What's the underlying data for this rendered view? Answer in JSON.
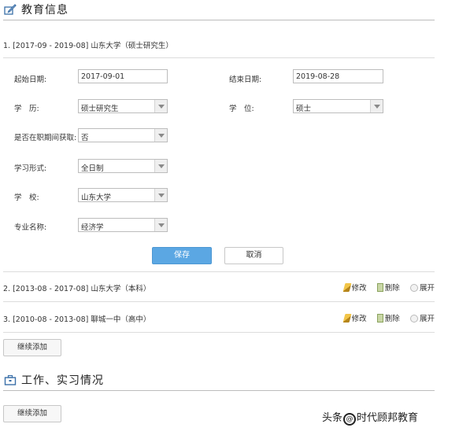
{
  "education": {
    "header_title": "教育信息",
    "expanded_entry": {
      "title": "1. [2017-09 - 2019-08] 山东大学（硕士研究生）",
      "fields": {
        "start_date_label": "起始日期:",
        "start_date_value": "2017-09-01",
        "end_date_label": "结束日期:",
        "end_date_value": "2019-08-28",
        "education_label": "学　历:",
        "education_value": "硕士研究生",
        "degree_label": "学　位:",
        "degree_value": "硕士",
        "during_job_label": "是否在职期间获取:",
        "during_job_value": "否",
        "study_mode_label": "学习形式:",
        "study_mode_value": "全日制",
        "school_label": "学　校:",
        "school_value": "山东大学",
        "major_label": "专业名称:",
        "major_value": "经济学"
      },
      "save_label": "保存",
      "cancel_label": "取消"
    },
    "entries": [
      {
        "title": "2. [2013-08 - 2017-08] 山东大学（本科）",
        "edit": "修改",
        "delete": "删除",
        "expand": "展开"
      },
      {
        "title": "3. [2010-08 - 2013-08] 聊城一中（高中）",
        "edit": "修改",
        "delete": "删除",
        "expand": "展开"
      }
    ],
    "add_label": "继续添加"
  },
  "work": {
    "header_title": "工作、实习情况",
    "add_label": "继续添加"
  },
  "watermark": {
    "prefix": "头条",
    "at": "@",
    "name": "时代顾邦教育"
  }
}
